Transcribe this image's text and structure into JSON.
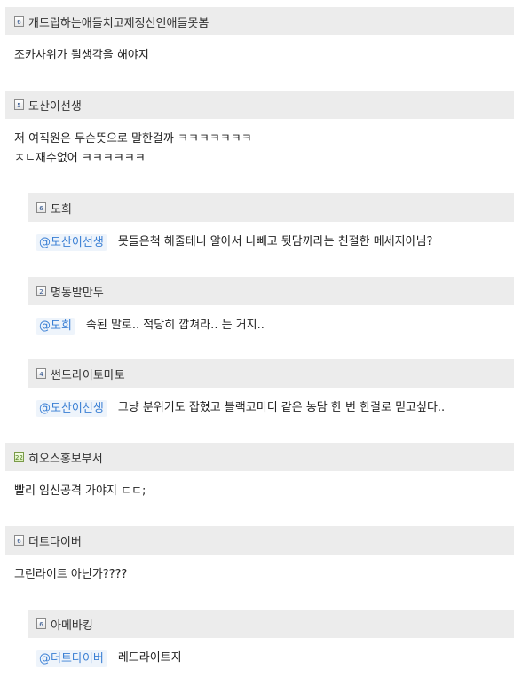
{
  "comments": [
    {
      "level": "6",
      "nick": "개드립하는애들치고제정신인애들못봄",
      "lines": [
        "조카사위가 될생각을 해야지"
      ]
    },
    {
      "level": "5",
      "nick": "도산이선생",
      "lines": [
        "저 여직원은 무슨뜻으로 말한걸까 ㅋㅋㅋㅋㅋㅋㅋ",
        "ㅈㄴ재수없어 ㅋㅋㅋㅋㅋㅋ"
      ]
    },
    {
      "level": "6",
      "nick": "도희",
      "mention": "@도산이선생",
      "text": "못들은척 해줄테니 알아서 나빼고 뒷담까라는 친절한 메세지아님?"
    },
    {
      "level": "2",
      "nick": "명동발만두",
      "mention": "@도희",
      "text": "속된 말로.. 적당히 깝쳐라.. 는 거지.."
    },
    {
      "level": "4",
      "nick": "썬드라이토마토",
      "mention": "@도산이선생",
      "text": "그냥 분위기도 잡혔고 블랙코미디 같은 농담 한 번 한걸로 믿고싶다.."
    },
    {
      "level": "22",
      "nick": "히오스홍보부서",
      "lines": [
        "빨리 임신공격 가야지 ㄷㄷ;"
      ]
    },
    {
      "level": "6",
      "nick": "더트다이버",
      "lines": [
        "그린라이트 아닌가????"
      ]
    },
    {
      "level": "6",
      "nick": "아메바킹",
      "mention": "@더트다이버",
      "text": "레드라이트지"
    }
  ]
}
